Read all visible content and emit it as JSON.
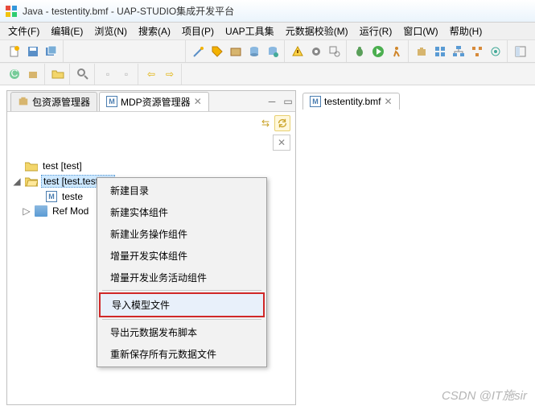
{
  "window": {
    "title": "Java - testentity.bmf - UAP-STUDIO集成开发平台"
  },
  "menu": {
    "file": "文件(F)",
    "edit": "编辑(E)",
    "browse": "浏览(N)",
    "search": "搜索(A)",
    "project": "项目(P)",
    "uaptools": "UAP工具集",
    "metadata": "元数据校验(M)",
    "run": "运行(R)",
    "window": "窗口(W)",
    "help": "帮助(H)"
  },
  "views": {
    "pkg_explorer": "包资源管理器",
    "mdp_explorer": "MDP资源管理器"
  },
  "editor": {
    "file": "testentity.bmf"
  },
  "tree": {
    "root1": "test [test]",
    "root2": "test [test.testbill]",
    "child_file": "teste",
    "ref": "Ref Mod"
  },
  "context_menu": {
    "new_dir": "新建目录",
    "new_entity": "新建实体组件",
    "new_bizop": "新建业务操作组件",
    "inc_entity": "增量开发实体组件",
    "inc_bizact": "增量开发业务活动组件",
    "import_model": "导入模型文件",
    "export_md": "导出元数据发布脚本",
    "resave": "重新保存所有元数据文件"
  },
  "watermark": "CSDN @IT施sir"
}
